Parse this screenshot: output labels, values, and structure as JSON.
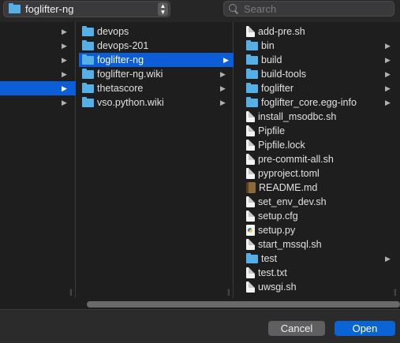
{
  "location": {
    "current_folder": "foglifter-ng",
    "updown_icon": "chevron-updown-icon"
  },
  "search": {
    "placeholder": "Search"
  },
  "column2": {
    "items": [
      {
        "label": "devops"
      },
      {
        "label": "devops-201"
      },
      {
        "label": "foglifter-ng"
      },
      {
        "label": "foglifter-ng.wiki"
      },
      {
        "label": "thetascore"
      },
      {
        "label": "vso.python.wiki"
      }
    ]
  },
  "column3": {
    "items": [
      {
        "label": "add-pre.sh",
        "icon": "file"
      },
      {
        "label": "bin",
        "icon": "folder"
      },
      {
        "label": "build",
        "icon": "folder"
      },
      {
        "label": "build-tools",
        "icon": "folder"
      },
      {
        "label": "foglifter",
        "icon": "folder"
      },
      {
        "label": "foglifter_core.egg-info",
        "icon": "folder"
      },
      {
        "label": "install_msodbc.sh",
        "icon": "file"
      },
      {
        "label": "Pipfile",
        "icon": "file"
      },
      {
        "label": "Pipfile.lock",
        "icon": "file"
      },
      {
        "label": "pre-commit-all.sh",
        "icon": "file"
      },
      {
        "label": "pyproject.toml",
        "icon": "file"
      },
      {
        "label": "README.md",
        "icon": "book"
      },
      {
        "label": "set_env_dev.sh",
        "icon": "file"
      },
      {
        "label": "setup.cfg",
        "icon": "file"
      },
      {
        "label": "setup.py",
        "icon": "python"
      },
      {
        "label": "start_mssql.sh",
        "icon": "file"
      },
      {
        "label": "test",
        "icon": "folder"
      },
      {
        "label": "test.txt",
        "icon": "file"
      },
      {
        "label": "uwsgi.sh",
        "icon": "file"
      }
    ]
  },
  "buttons": {
    "cancel": "Cancel",
    "open": "Open"
  },
  "colors": {
    "accent": "#0a64d6",
    "folder": "#55b0e8",
    "background": "#1e1e1e"
  }
}
